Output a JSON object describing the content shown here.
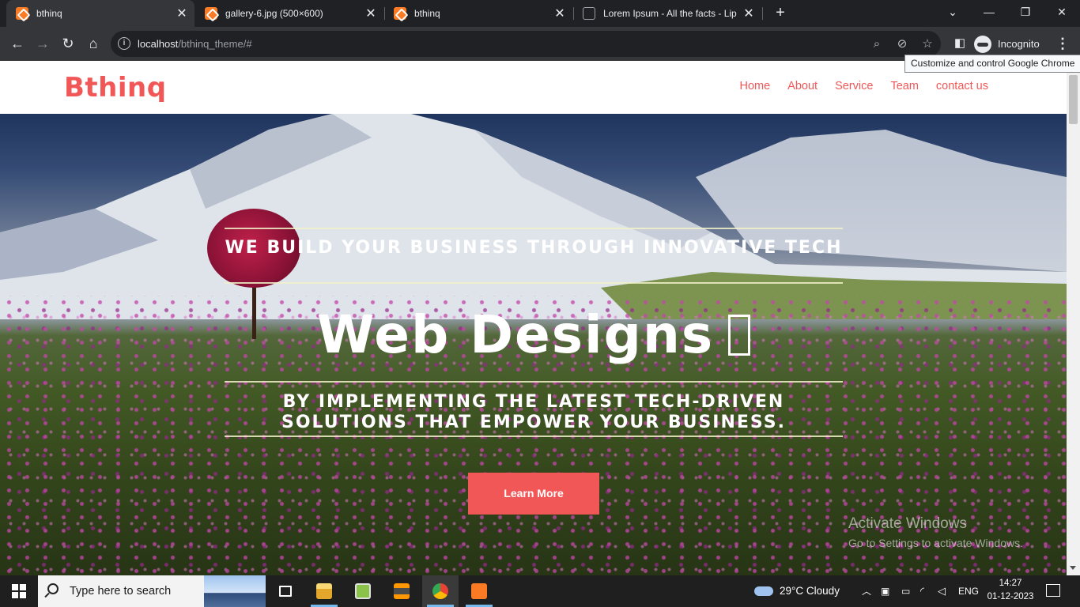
{
  "browser": {
    "tabs": [
      {
        "title": "bthinq",
        "favicon": "xampp-icon",
        "active": true
      },
      {
        "title": "gallery-6.jpg (500×600)",
        "favicon": "xampp-icon",
        "active": false
      },
      {
        "title": "bthinq",
        "favicon": "xampp-icon",
        "active": false
      },
      {
        "title": "Lorem Ipsum - All the facts - Lip",
        "favicon": "document-icon",
        "active": false
      }
    ],
    "tab_close_glyph": "✕",
    "new_tab_glyph": "+",
    "window_controls": {
      "minimize": "—",
      "restore": "❐",
      "close": "✕",
      "tab_search": "⌄"
    },
    "url": {
      "host": "localhost",
      "path": "/bthinq_theme/#"
    },
    "profile_label": "Incognito",
    "tooltip": "Customize and control Google Chrome"
  },
  "site": {
    "logo": "Bthinq",
    "nav": [
      "Home",
      "About",
      "Service",
      "Team",
      "contact us"
    ],
    "accent_color": "#f25757"
  },
  "hero": {
    "tagline": "We build your business through innovative tech",
    "headline": "Web Designs",
    "subline": "by implementing the latest tech-driven solutions that empower your business.",
    "cta_label": "Learn More"
  },
  "watermark": {
    "line1": "Activate Windows",
    "line2": "Go to Settings to activate Windows."
  },
  "taskbar": {
    "search_placeholder": "Type here to search",
    "weather": "29°C  Cloudy",
    "language": "ENG",
    "time": "14:27",
    "date": "01-12-2023"
  }
}
